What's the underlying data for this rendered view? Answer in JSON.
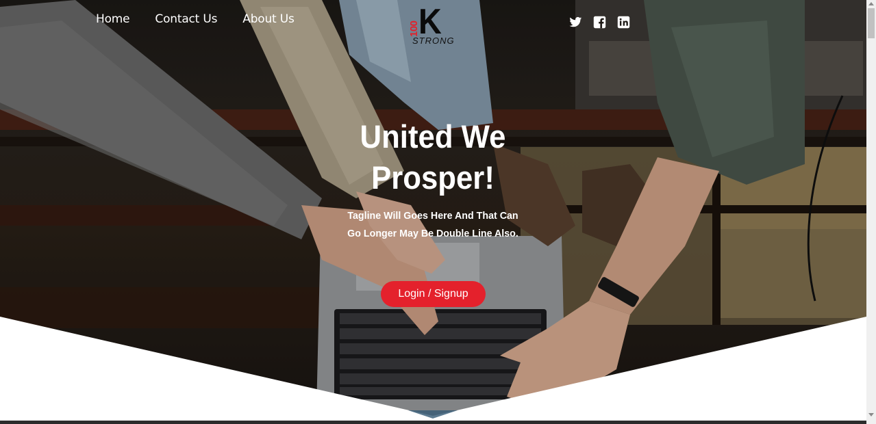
{
  "nav": {
    "items": [
      {
        "label": "Home"
      },
      {
        "label": "Contact Us"
      },
      {
        "label": "About Us"
      }
    ]
  },
  "logo": {
    "number": "100",
    "letter": "K",
    "word": "STRONG"
  },
  "social": {
    "icons": [
      "twitter-icon",
      "facebook-icon",
      "linkedin-icon"
    ]
  },
  "hero": {
    "headline_line1": "United We",
    "headline_line2": "Prosper!",
    "tagline_line1": "Tagline Will Goes Here And That Can",
    "tagline_line2": "Go Longer May Be Double Line Also.",
    "cta_label": "Login / Signup"
  },
  "colors": {
    "accent": "#e4212c",
    "text": "#ffffff",
    "logo_dark": "#0a0a0a"
  }
}
